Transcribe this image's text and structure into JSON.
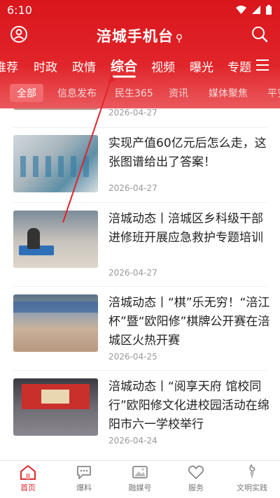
{
  "status": {
    "time": "6:10"
  },
  "app": {
    "title": "涪城手机台",
    "pin_icon": "location-pin-icon"
  },
  "channels": [
    {
      "label": "推荐",
      "active": false
    },
    {
      "label": "时政",
      "active": false
    },
    {
      "label": "政情",
      "active": false
    },
    {
      "label": "综合",
      "active": true
    },
    {
      "label": "视频",
      "active": false
    },
    {
      "label": "曝光",
      "active": false
    },
    {
      "label": "专题",
      "active": false
    }
  ],
  "subtabs": [
    {
      "label": "全部",
      "active": true
    },
    {
      "label": "信息发布",
      "active": false
    },
    {
      "label": "民生365",
      "active": false
    },
    {
      "label": "资讯",
      "active": false
    },
    {
      "label": "媒体聚焦",
      "active": false
    },
    {
      "label": "平安",
      "active": false
    }
  ],
  "articles": [
    {
      "title": "",
      "date": "2026-04-27"
    },
    {
      "title": "实现产值60亿元后怎么走，这张图谱给出了答案！",
      "date": "2026-04-27"
    },
    {
      "title": "涪城动态丨涪城区乡科级干部进修班开展应急救护专题培训",
      "date": "2026-04-27"
    },
    {
      "title": "涪城动态丨“棋”乐无穷！“涪江杯”暨“欧阳修”棋牌公开赛在涪城区火热开赛",
      "date": "2026-04-25"
    },
    {
      "title": "涪城动态丨“阅享天府 馆校同行”欧阳修文化进校园活动在绵阳市六一学校举行",
      "date": "2026-04-24"
    }
  ],
  "bottom_nav": [
    {
      "label": "首页",
      "icon": "home-icon",
      "active": true
    },
    {
      "label": "爆料",
      "icon": "chat-bubble-icon",
      "active": false
    },
    {
      "label": "融媒号",
      "icon": "image-icon",
      "active": false
    },
    {
      "label": "服务",
      "icon": "heart-icon",
      "active": false
    },
    {
      "label": "文明实践",
      "icon": "torch-icon",
      "active": false
    }
  ],
  "colors": {
    "brand_red": "#e0252a"
  }
}
